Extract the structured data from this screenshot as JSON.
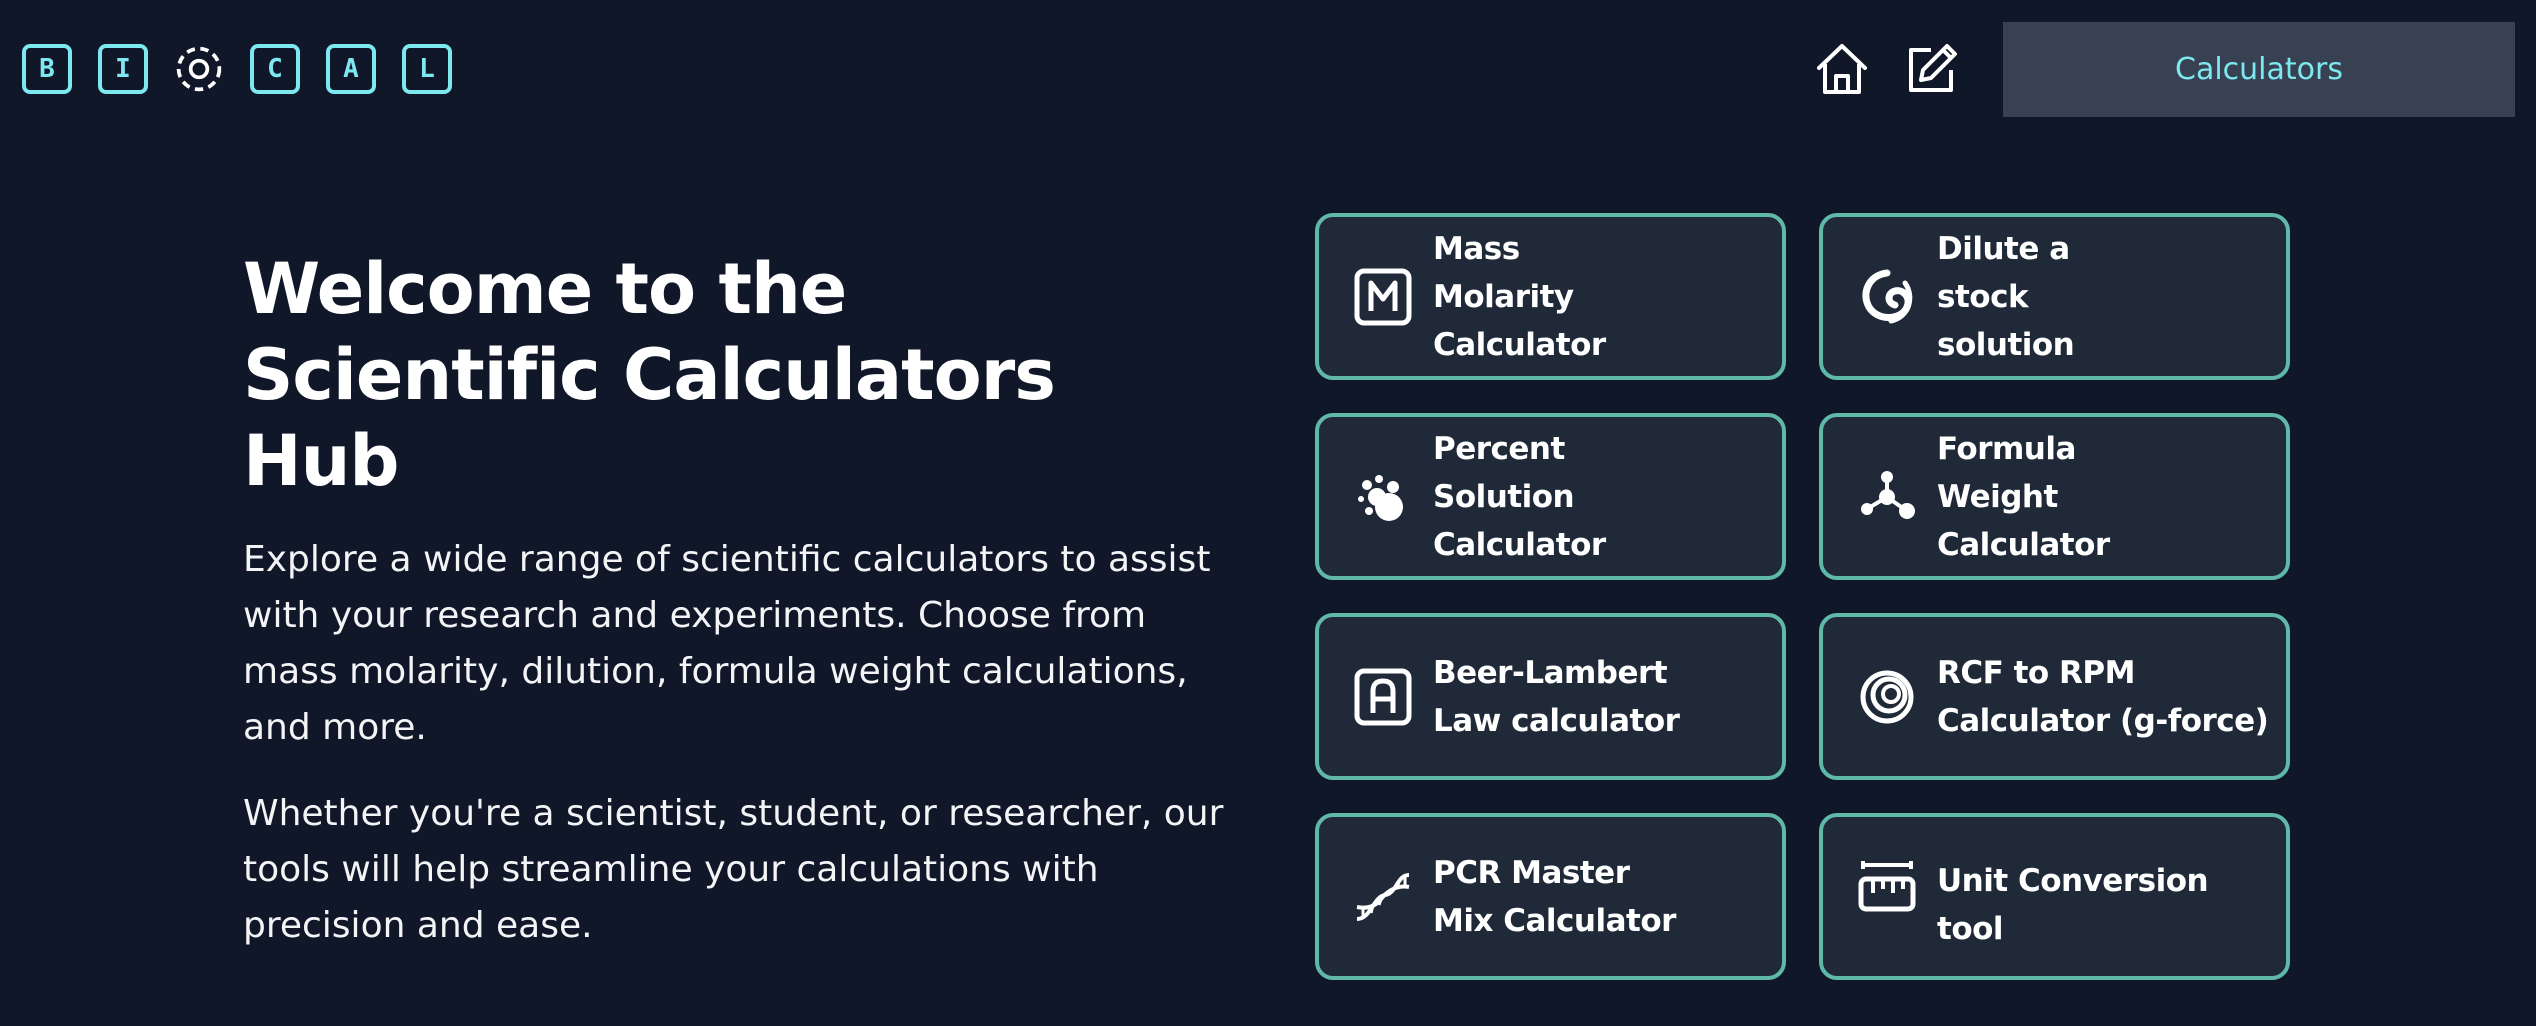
{
  "header": {
    "logo_letters": [
      "B",
      "I",
      "C",
      "A",
      "L"
    ],
    "nav": {
      "calculators_label": "Calculators"
    }
  },
  "hero": {
    "title": "Welcome to the Scientific Calculators Hub",
    "paragraph1": "Explore a wide range of scientific calculators to assist with your research and experiments. Choose from mass molarity, dilution, formula weight calculations, and more.",
    "paragraph2": "Whether you're a scientist, student, or researcher, our tools will help streamline your calculations with precision and ease."
  },
  "calculators": [
    {
      "label": "Mass Molarity Calculator",
      "icon": "m-box-icon"
    },
    {
      "label": "Dilute a stock solution",
      "icon": "swirl-icon"
    },
    {
      "label": "Percent Solution Calculator",
      "icon": "bubbles-icon"
    },
    {
      "label": "Formula Weight Calculator",
      "icon": "molecule-icon"
    },
    {
      "label": "Beer-Lambert Law calculator",
      "icon": "a-box-icon"
    },
    {
      "label": "RCF to RPM Calculator (g-force)",
      "icon": "spiral-icon"
    },
    {
      "label": "PCR Master Mix Calculator",
      "icon": "dna-icon"
    },
    {
      "label": "Unit Conversion tool",
      "icon": "ruler-icon"
    }
  ],
  "colors": {
    "background": "#0f1729",
    "card_background": "#1f2937",
    "card_border": "#5fb8a8",
    "accent": "#7ee8f0",
    "nav_button": "#374151"
  }
}
